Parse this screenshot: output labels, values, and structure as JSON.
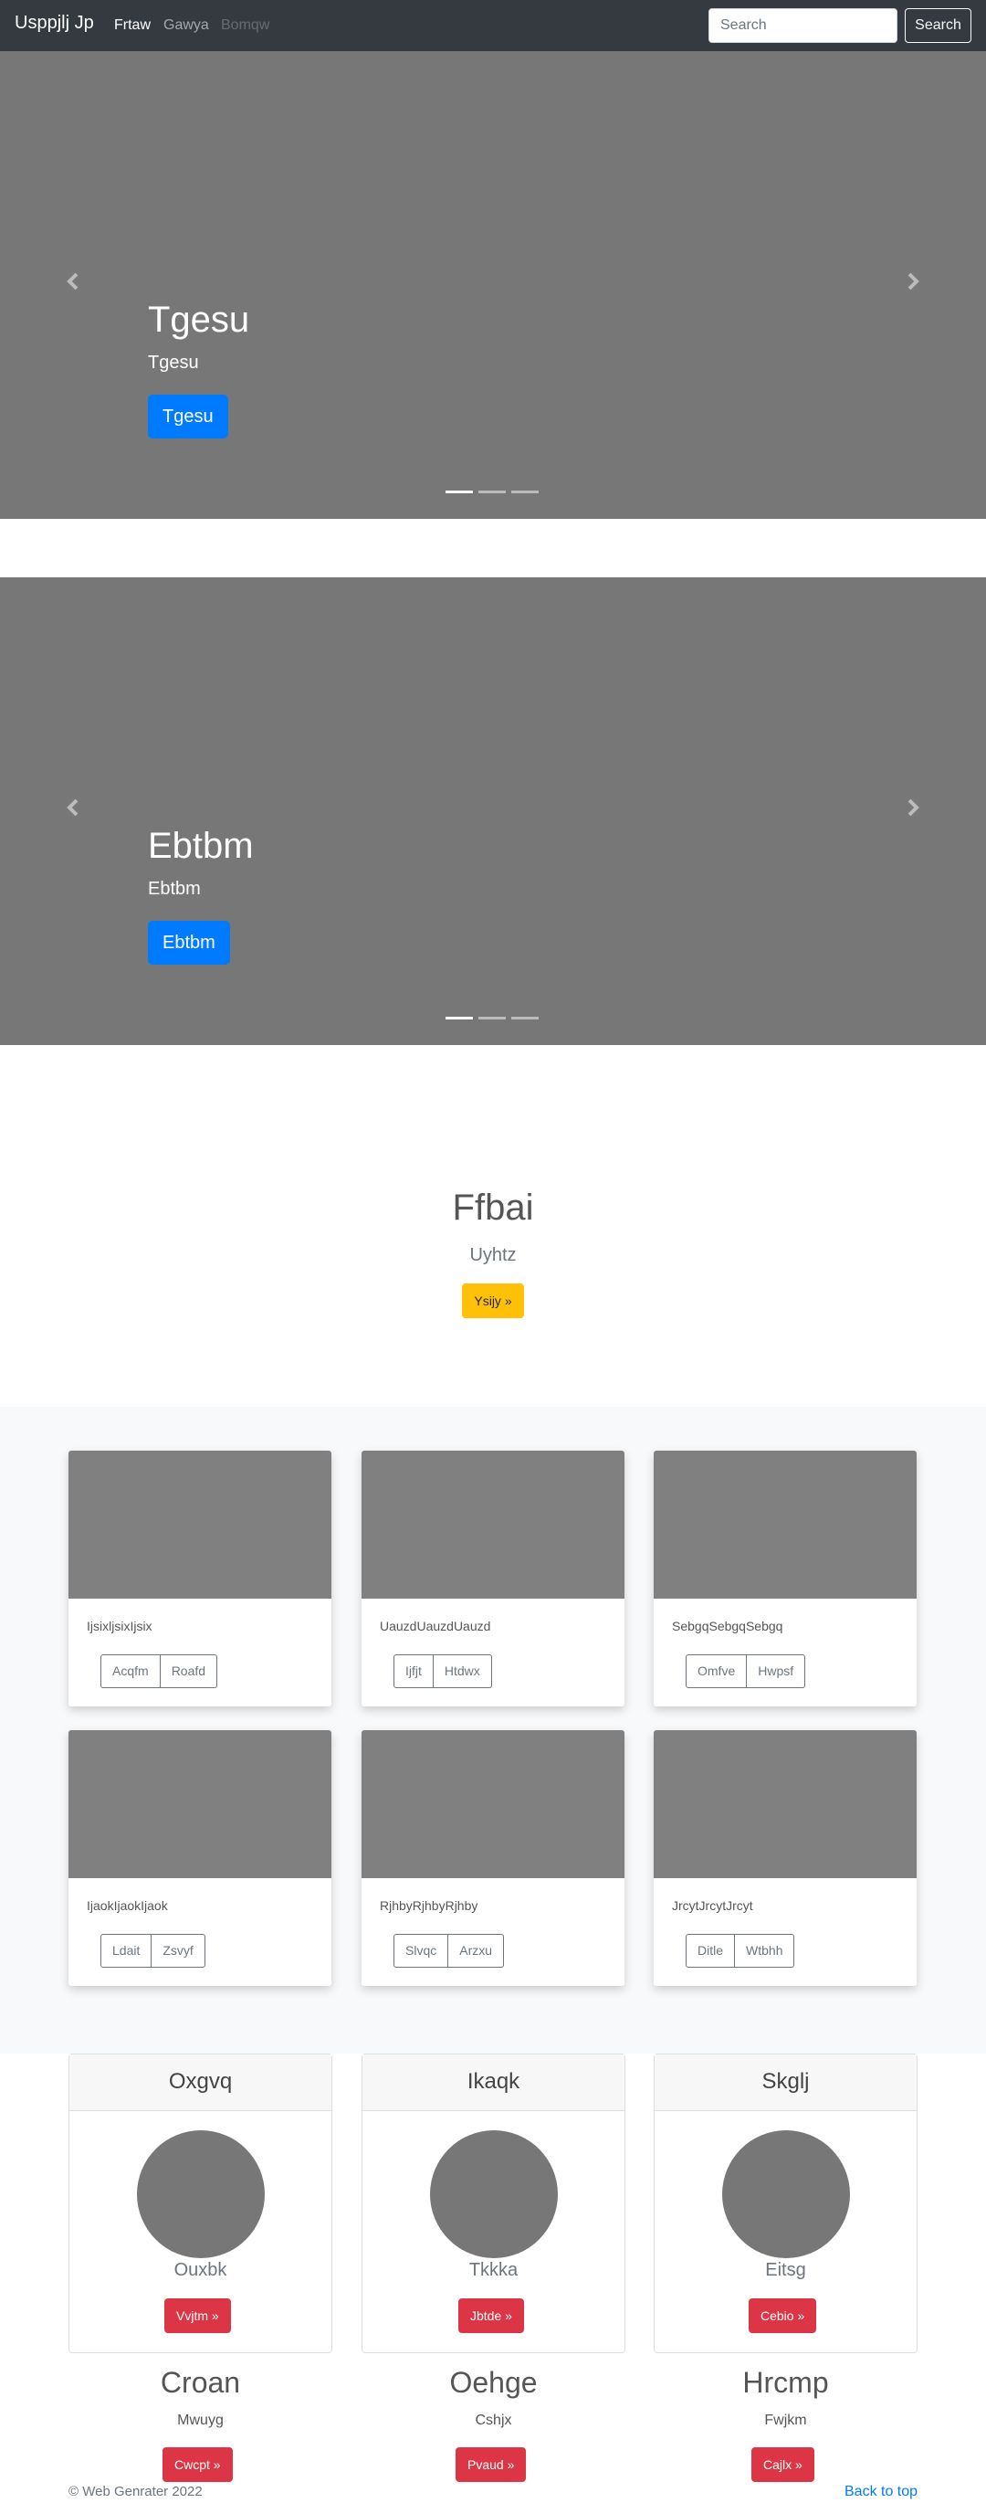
{
  "navbar": {
    "brand": "Usppjlj Jp",
    "links": [
      "Frtaw",
      "Gawya",
      "Bomqw"
    ],
    "search_placeholder": "Search",
    "search_button": "Search"
  },
  "carousels": [
    {
      "title": "Tgesu",
      "text": "Tgesu",
      "button": "Tgesu"
    },
    {
      "title": "Ebtbm",
      "text": "Ebtbm",
      "button": "Ebtbm"
    }
  ],
  "jumbotron": {
    "title": "Ffbai",
    "lead": "Uyhtz",
    "button": "Ysijy »"
  },
  "album": {
    "cards": [
      {
        "text": "IjsixljsixIjsix",
        "buttons": [
          "Acqfm",
          "Roafd"
        ]
      },
      {
        "text": "UauzdUauzdUauzd",
        "buttons": [
          "Ijfjt",
          "Htdwx"
        ]
      },
      {
        "text": "SebgqSebgqSebgq",
        "buttons": [
          "Omfve",
          "Hwpsf"
        ]
      },
      {
        "text": "IjaokIjaokIjaok",
        "buttons": [
          "Ldait",
          "Zsvyf"
        ]
      },
      {
        "text": "RjhbyRjhbyRjhby",
        "buttons": [
          "Slvqc",
          "Arzxu"
        ]
      },
      {
        "text": "JrcytJrcytJrcyt",
        "buttons": [
          "Ditle",
          "Wtbhh"
        ]
      }
    ]
  },
  "pricing": [
    {
      "header": "Oxgvq",
      "name": "Ouxbk",
      "button": "Vvjtm »"
    },
    {
      "header": "Ikaqk",
      "name": "Tkkka",
      "button": "Jbtde »"
    },
    {
      "header": "Skglj",
      "name": "Eitsg",
      "button": "Cebio »"
    }
  ],
  "features": [
    {
      "title": "Croan",
      "text": "Mwuyg",
      "button": "Cwcpt »"
    },
    {
      "title": "Oehge",
      "text": "Cshjx",
      "button": "Pvaud »"
    },
    {
      "title": "Hrcmp",
      "text": "Fwjkm",
      "button": "Cajlx »"
    }
  ],
  "footer": {
    "copyright": "© Web Genrater 2022",
    "back_to_top": "Back to top"
  }
}
